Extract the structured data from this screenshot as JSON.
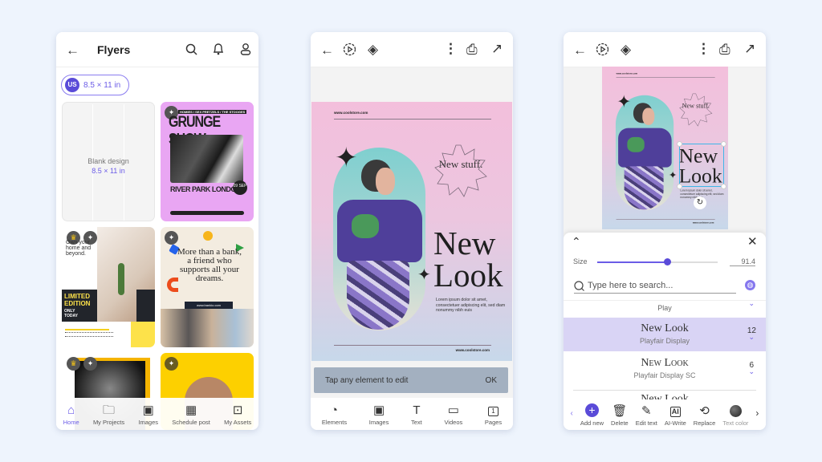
{
  "screen1": {
    "title": "Flyers",
    "chip": {
      "badge": "US",
      "label": "8.5 × 11 in"
    },
    "blank": {
      "title": "Blank design",
      "size": "8.5 × 11 in"
    },
    "templates": [
      {
        "top": "HOMIES / SEX PRETZELS / THE STOOGES",
        "title": "GRUNGE SHOW",
        "subtitle": "RIVER PARK LONDON",
        "date": "09 SEP"
      },
      {
        "headline": "Own your home and beyond.",
        "tag1": "LIMITED EDITION",
        "tag2": "ONLY TODAY"
      },
      {
        "headline": "More than a bank, a friend who supports all your dreams.",
        "url": "www.bankio.com"
      }
    ],
    "nav": [
      {
        "label": "Home",
        "icon": "home-icon"
      },
      {
        "label": "My Projects",
        "icon": "folder-icon"
      },
      {
        "label": "Images",
        "icon": "image-icon"
      },
      {
        "label": "Schedule post",
        "icon": "calendar-icon"
      },
      {
        "label": "My Assets",
        "icon": "briefcase-icon"
      }
    ]
  },
  "flyer": {
    "url": "www.coolstore.com",
    "burst": "New stuff.",
    "headline1": "New",
    "headline2": "Look",
    "body": "Lorem ipsum dolor sit amet, consectetuer adipiscing elit, sed diam nonummy nibh euis"
  },
  "screen2": {
    "toast": {
      "message": "Tap any element to edit",
      "ok": "OK"
    },
    "tools": [
      {
        "label": "Elements",
        "icon": "shapes-icon"
      },
      {
        "label": "Images",
        "icon": "image-icon"
      },
      {
        "label": "Text",
        "icon": "text-icon"
      },
      {
        "label": "Videos",
        "icon": "video-icon"
      },
      {
        "label": "Pages",
        "icon": "pages-icon",
        "count": "1"
      }
    ]
  },
  "screen3": {
    "size_label": "Size",
    "size_value": "91.4",
    "size_fraction": 0.58,
    "search_placeholder": "Type here to search...",
    "fonts": [
      {
        "preview": "Play",
        "name": ""
      },
      {
        "preview": "New Look",
        "name": "Playfair Display",
        "count": "12",
        "selected": true
      },
      {
        "preview": "New Look",
        "name": "Playfair Display SC",
        "count": "6"
      },
      {
        "preview": "New Look",
        "name": ""
      }
    ],
    "tools": [
      {
        "label": "Add new",
        "icon": "plus-icon"
      },
      {
        "label": "Delete",
        "icon": "trash-icon"
      },
      {
        "label": "Edit text",
        "icon": "pencil-icon"
      },
      {
        "label": "AI-Write",
        "icon": "ai-icon"
      },
      {
        "label": "Replace",
        "icon": "replace-icon"
      },
      {
        "label": "Text color",
        "icon": "color-dot-icon"
      }
    ]
  },
  "colors": {
    "accent": "#6b5ce7",
    "selected_row": "#d9d4f5",
    "background": "#eef4fd"
  }
}
